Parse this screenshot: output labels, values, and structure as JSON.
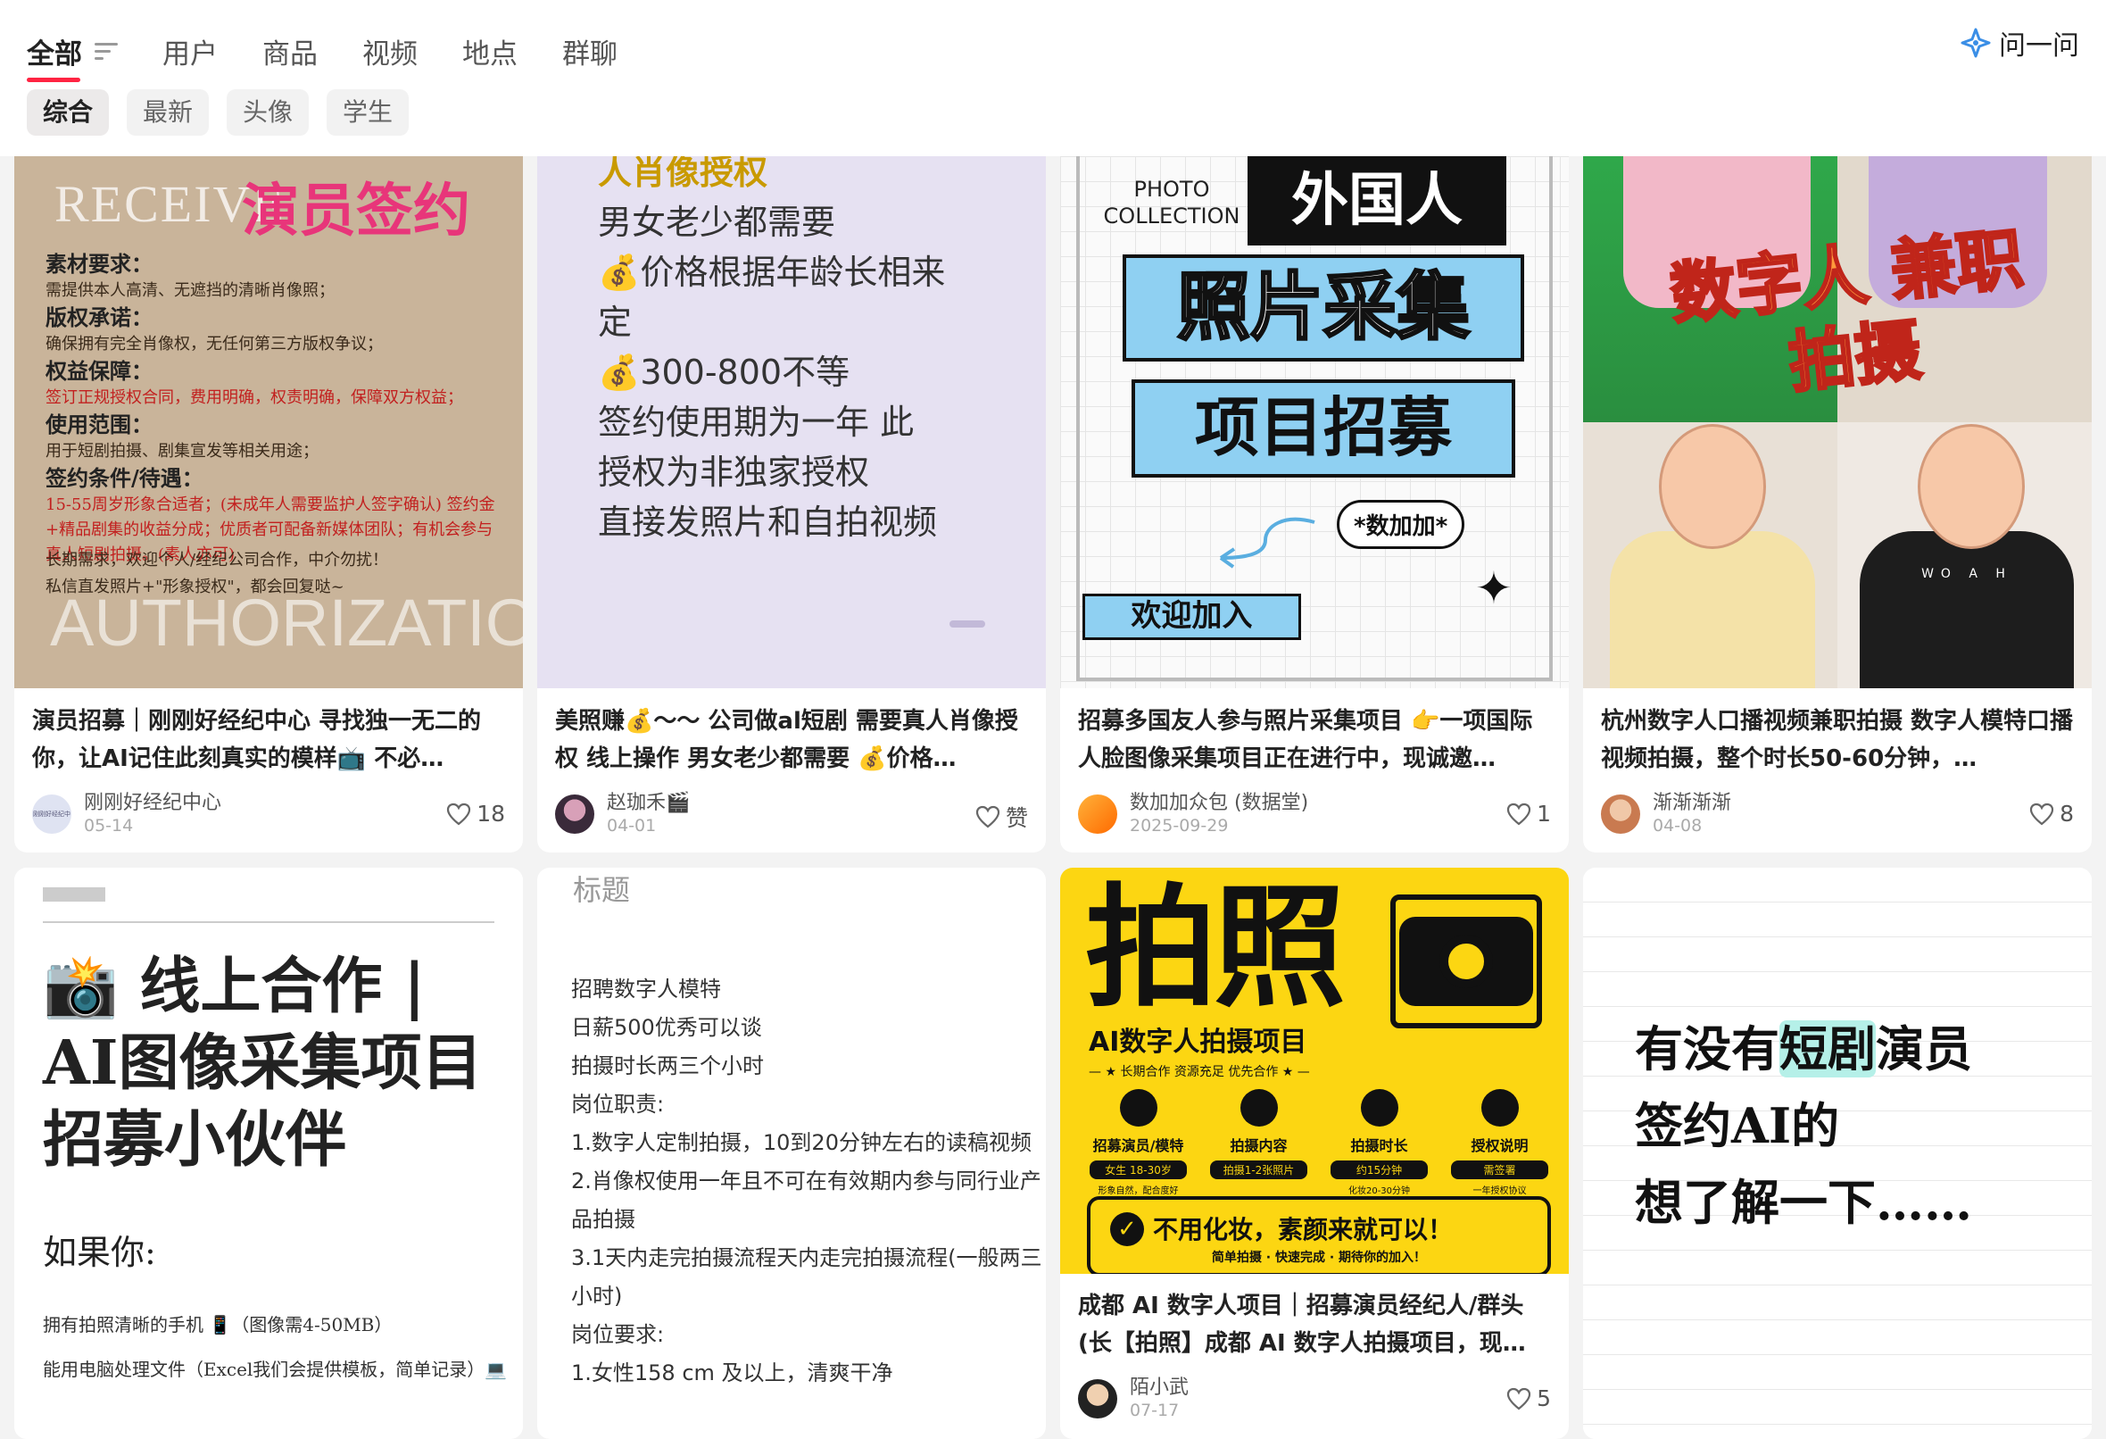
{
  "header": {
    "tabs": [
      "全部",
      "用户",
      "商品",
      "视频",
      "地点",
      "群聊"
    ],
    "active_tab": "全部",
    "ask_label": "问一问",
    "subtabs": [
      "综合",
      "最新",
      "头像",
      "学生"
    ],
    "active_subtab": "综合"
  },
  "cards": [
    {
      "title": "演员招募｜刚刚好经纪中心 寻找独一无二的你，让AI记住此刻真实的模样📺 不必…",
      "author": "刚刚好经纪中心",
      "date": "05-14",
      "likes": "18",
      "avatar_text": "刚刚好经纪中心",
      "cover": {
        "receive": "RECEIVE",
        "heading": "演员签约",
        "sections": [
          {
            "h": "素材要求：",
            "b": "需提供本人高清、无遮挡的清晰肖像照；"
          },
          {
            "h": "版权承诺：",
            "b": "确保拥有完全肖像权，无任何第三方版权争议；"
          },
          {
            "h": "权益保障：",
            "b": "签订正规授权合同，费用明确，权责明确，保障双方权益；"
          },
          {
            "h": "使用范围：",
            "b": "用于短剧拍摄、剧集宣发等相关用途；"
          },
          {
            "h": "签约条件/待遇：",
            "b": "15-55周岁形象合适者；(未成年人需要监护人签字确认) 签约金+精品剧集的收益分成；优质者可配备新媒体团队；有机会参与真人短剧拍摄。(素人亦可)"
          }
        ],
        "note1": "长期需求，欢迎个人/经纪公司合作，中介勿扰！",
        "note2": "私信直发照片+\"形象授权\"，都会回复哒~",
        "authorization": "AUTHORIZATION"
      }
    },
    {
      "title": "美照赚💰～～ 公司做al短剧 需要真人肖像授权 线上操作 男女老少都需要 💰价格…",
      "author": "赵珈禾🎬",
      "date": "04-01",
      "likes": "赞",
      "cover": {
        "lines": [
          "人肖像授权",
          "男女老少都需要",
          "💰价格根据年龄长相来",
          "定",
          "💰300-800不等",
          "签约使用期为一年 此",
          "授权为非独家授权",
          "直接发照片和自拍视频"
        ]
      }
    },
    {
      "title": "招募多国友人参与照片采集项目 👉一项国际人脸图像采集项目正在进行中，现诚邀…",
      "author": "数加加众包 (数据堂)",
      "date": "2025-09-29",
      "likes": "1",
      "cover": {
        "photo": "PHOTO COLLECTION",
        "line1": "外国人",
        "line2": "照片采集",
        "line3": "项目招募",
        "tag": "*数加加*",
        "welcome": "欢迎加入"
      }
    },
    {
      "title": "杭州数字人口播视频兼职拍摄 数字人模特口播视频拍摄，整个时长50-60分钟，…",
      "author": "渐渐渐渐",
      "date": "04-08",
      "likes": "8",
      "cover": {
        "big": "数字人 兼职拍摄",
        "shirt_text": "WO A H"
      }
    },
    {
      "cover": {
        "title": "📸 线上合作 | AI图像采集项目招募小伙伴",
        "ru": "如果你:",
        "item1": "拥有拍照清晰的手机 📱（图像需4-50MB）",
        "item2": "能用电脑处理文件（Excel我们会提供模板，简单记录）💻"
      }
    },
    {
      "cover": {
        "heading": "标题",
        "lines": [
          "招聘数字人模特",
          "日薪500优秀可以谈",
          "拍摄时长两三个小时",
          "岗位职责:",
          "1.数字人定制拍摄，10到20分钟左右的读稿视频",
          "2.肖像权使用一年且不可在有效期内参与同行业产品拍摄",
          "3.1天内走完拍摄流程天内走完拍摄流程(一般两三小时)",
          "岗位要求:",
          "1.女性158 cm 及以上，清爽干净"
        ]
      }
    },
    {
      "title": "成都 AI 数字人项目｜招募演员经纪人/群头(长【拍照】成都 AI 数字人拍摄项目，现…",
      "author": "陌小武",
      "date": "07-17",
      "likes": "5",
      "cover": {
        "pz": "拍照",
        "sub": "AI数字人拍摄项目",
        "tags": "— ★ 长期合作   资源充足   优先合作 ★ —",
        "items": [
          {
            "l1": "招募演员/模特",
            "l2": "女生 18-30岁",
            "l3": "形象自然，配合度好"
          },
          {
            "l1": "拍摄内容",
            "l2": "拍摄1-2张照片",
            "l3": ""
          },
          {
            "l1": "拍摄时长",
            "l2": "约15分钟",
            "l3": "化妆20-30分钟"
          },
          {
            "l1": "授权说明",
            "l2": "需签署",
            "l3": "一年授权协议"
          }
        ],
        "main": "不用化妆，素颜来就可以！",
        "small": "简单拍摄 · 快速完成 · 期待你的加入！"
      }
    },
    {
      "cover": {
        "pre": "有没有",
        "hl": "短剧",
        "post": "演员",
        "line2": "签约AI的",
        "line3": "想了解一下……"
      }
    }
  ],
  "colors": {
    "accent": "#ff2442",
    "page_bg": "#f3f3f3",
    "lavender": "#e6e1f2",
    "yellow": "#fcd612",
    "sky": "#8fd0f2"
  }
}
